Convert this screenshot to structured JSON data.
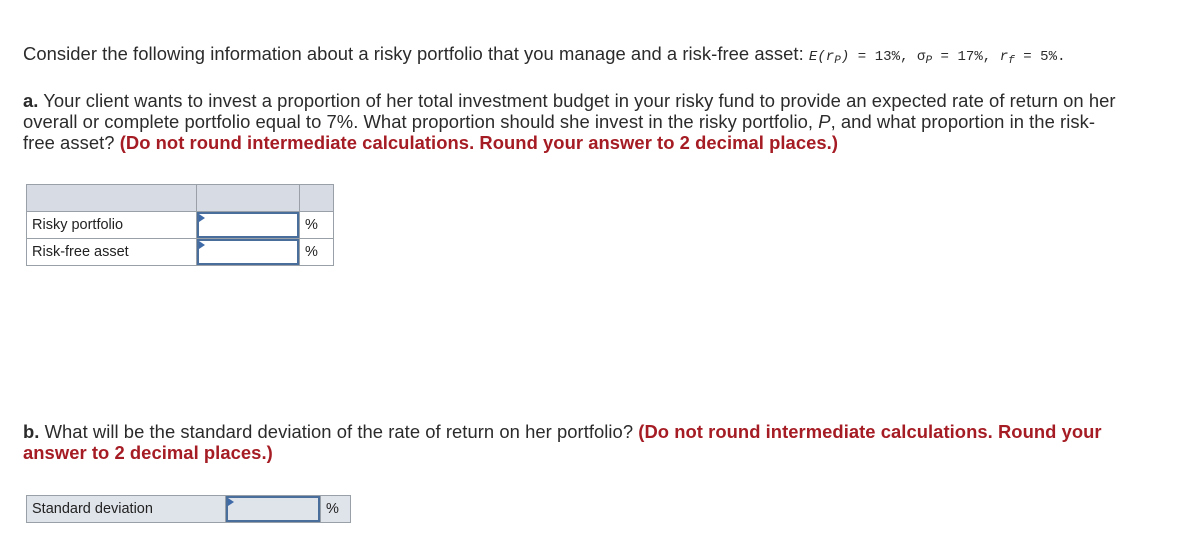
{
  "intro": {
    "text": "Consider the following information about a risky portfolio that you manage and a risk-free asset: ",
    "formula": {
      "er_label": "E(r",
      "er_sub": "P",
      "er_close": ")",
      "er_value": " = 13%, ",
      "sigma_label": "σ",
      "sigma_sub": "P",
      "sigma_value": " = 17%, ",
      "rf_label": "r",
      "rf_sub": "f",
      "rf_value": " = 5%."
    }
  },
  "part_a": {
    "label": "a.",
    "line1": " Your client wants to invest a proportion of her total investment budget in your risky fund to provide an expected rate of return on her",
    "line2_pre": "overall or complete portfolio equal to 7%. What proportion should she invest in the risky portfolio, ",
    "line2_var": "P",
    "line2_post": ", and what proportion in the risk-",
    "line3": "free asset? ",
    "instruction": "(Do not round intermediate calculations. Round your answer to 2 decimal places.)",
    "table": {
      "rows": [
        {
          "label": "Risky portfolio",
          "value": "",
          "unit": "%"
        },
        {
          "label": "Risk-free asset",
          "value": "",
          "unit": "%"
        }
      ]
    }
  },
  "part_b": {
    "label": "b.",
    "line1": " What will be the standard deviation of the rate of return on her portfolio? ",
    "instruction_line1": "(Do not round intermediate calculations. Round your",
    "instruction_line2": "answer to 2 decimal places.)",
    "table": {
      "rows": [
        {
          "label": "Standard deviation",
          "value": "",
          "unit": "%"
        }
      ]
    }
  },
  "colors": {
    "instruction_red": "#a51c24",
    "input_border": "#4a6e9b",
    "header_fill": "#d7dbe3"
  }
}
